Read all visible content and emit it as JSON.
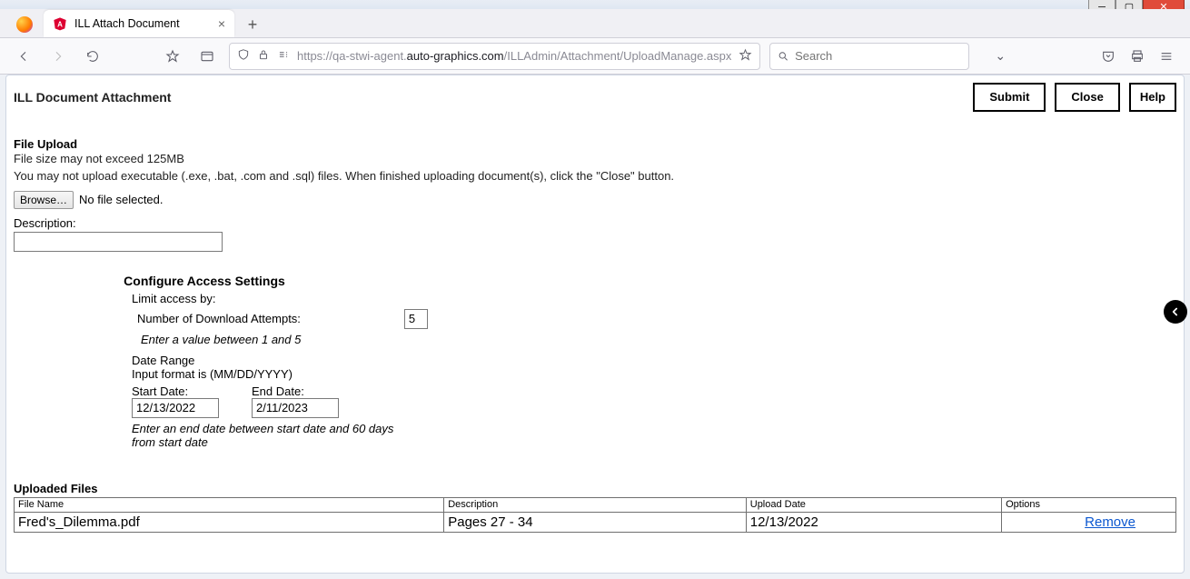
{
  "window": {
    "tab_title": "ILL Attach Document",
    "url": "https://qa-stwi-agent.auto-graphics.com/ILLAdmin/Attachment/UploadManage.aspx",
    "url_domain": "auto-graphics.com",
    "search_placeholder": "Search"
  },
  "header": {
    "title": "ILL Document Attachment",
    "submit": "Submit",
    "close": "Close",
    "help": "Help"
  },
  "upload": {
    "section": "File Upload",
    "size_hint": "File size may not exceed 125MB",
    "type_hint": "You may not upload executable (.exe, .bat, .com and .sql) files. When finished uploading document(s), click the \"Close\" button.",
    "browse": "Browse…",
    "nofile": "No file selected.",
    "desc_label": "Description:"
  },
  "config": {
    "title": "Configure Access Settings",
    "limit_label": "Limit access by:",
    "attempts_label": "Number of Download Attempts:",
    "attempts_value": "5",
    "attempts_hint": "Enter a value between 1 and 5",
    "daterange_label": "Date Range",
    "format_hint": "Input format is (MM/DD/YYYY)",
    "start_label": "Start Date:",
    "end_label": "End Date:",
    "start_value": "12/13/2022",
    "end_value": "2/11/2023",
    "end_hint": "Enter an end date between start date and 60 days from start date"
  },
  "files": {
    "section": "Uploaded Files",
    "cols": {
      "name": "File Name",
      "desc": "Description",
      "date": "Upload Date",
      "opts": "Options"
    },
    "rows": [
      {
        "name": "Fred's_Dilemma.pdf",
        "desc": "Pages 27 - 34",
        "date": "12/13/2022",
        "remove": "Remove"
      }
    ]
  }
}
